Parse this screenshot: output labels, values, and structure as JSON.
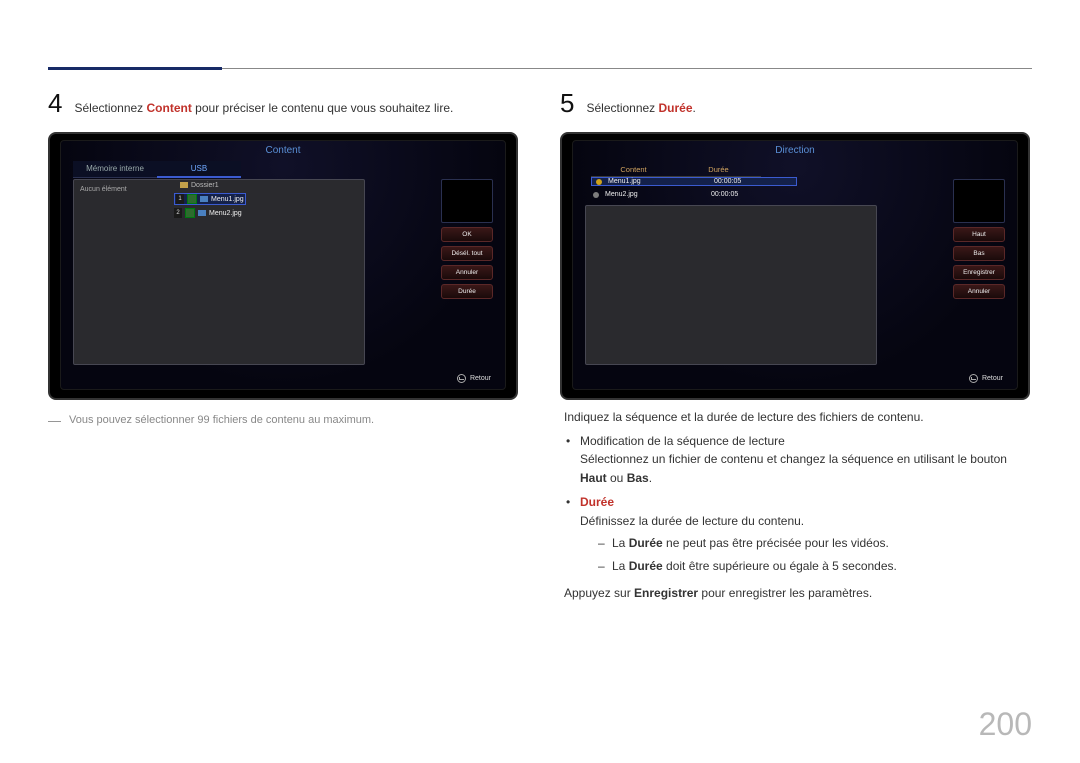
{
  "page_number": "200",
  "step4": {
    "num": "4",
    "text_a": "Sélectionnez ",
    "content_word": "Content",
    "text_b": " pour préciser le contenu que vous souhaitez lire.",
    "device": {
      "title": "Content",
      "tab1": "Mémoire interne",
      "tab2": "USB",
      "no_item": "Aucun élément",
      "folder": "Dossier1",
      "file1": "Menu1.jpg",
      "file2": "Menu2.jpg",
      "btn_ok": "OK",
      "btn_desel": "Désél. tout",
      "btn_cancel": "Annuler",
      "btn_duree": "Durée",
      "return": "Retour"
    },
    "footnote": "Vous pouvez sélectionner 99 fichiers de contenu au maximum."
  },
  "step5": {
    "num": "5",
    "text_a": "Sélectionnez ",
    "duree_word": "Durée",
    "text_b": ".",
    "device": {
      "title": "Direction",
      "col1": "Content",
      "col2": "Durée",
      "row1_name": "Menu1.jpg",
      "row1_dur": "00:00:05",
      "row2_name": "Menu2.jpg",
      "row2_dur": "00:00:05",
      "btn_up": "Haut",
      "btn_down": "Bas",
      "btn_save": "Enregistrer",
      "btn_cancel": "Annuler",
      "return": "Retour"
    },
    "intro": "Indiquez la séquence et la durée de lecture des fichiers de contenu.",
    "b1": "Modification de la séquence de lecture",
    "b1_sub_a": "Sélectionnez un fichier de contenu et changez la séquence en utilisant le bouton ",
    "haut": "Haut",
    "b1_sub_ou": " ou ",
    "bas": "Bas",
    "b1_sub_end": ".",
    "b2_title": "Durée",
    "b2_desc": "Définissez la durée de lecture du contenu.",
    "b2_s1_a": "La ",
    "b2_s1_b": " ne peut pas être précisée pour les vidéos.",
    "b2_s2_a": "La ",
    "b2_s2_b": " doit être supérieure ou égale à 5 secondes.",
    "save_a": "Appuyez sur ",
    "save_word": "Enregistrer",
    "save_b": " pour enregistrer les paramètres."
  }
}
